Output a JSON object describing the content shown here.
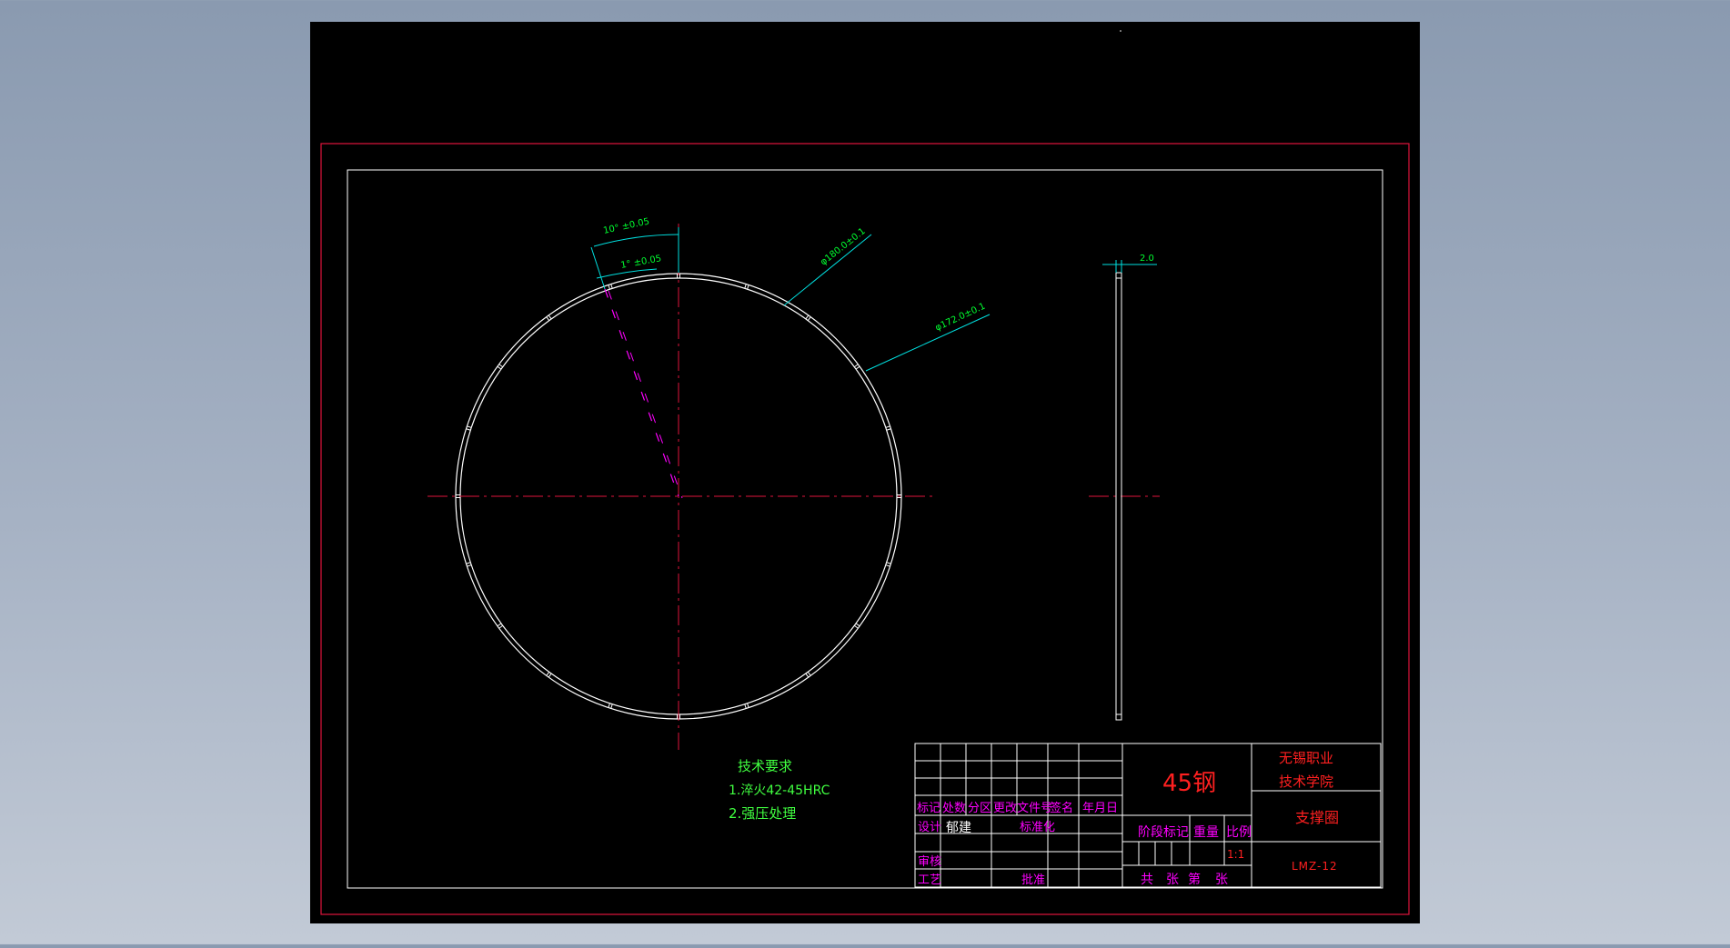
{
  "colors": {
    "background_top": "#8a9ab0",
    "canvas": "#000000",
    "outer_frame": "#e0143c",
    "geometry": "#ffffff",
    "center_line": "#e0143c",
    "dimension": "#00e0e0",
    "dimension_text": "#00ff30",
    "magenta": "#ff00ff",
    "title_red": "#ff2020",
    "tech_green": "#40ff40"
  },
  "dimensions": {
    "angle_outer": "10° ±0.05",
    "angle_inner": "1° ±0.05",
    "outer_diameter": "φ180.0±0.1",
    "inner_diameter": "φ172.0±0.1",
    "thickness": "2.0"
  },
  "tech_requirements": {
    "title": "技术要求",
    "items": [
      "1.淬火42-45HRC",
      "2.强压处理"
    ]
  },
  "title_block": {
    "material": "45钢",
    "school_line1": "无锡职业",
    "school_line2": "技术学院",
    "part_name": "支撑圈",
    "drawing_no": "LMZ-12",
    "revision_header": [
      "标记",
      "处数",
      "分区",
      "更改文件号",
      "签名",
      "年月日"
    ],
    "design_label": "设计",
    "designer": "郁建",
    "standardization_label": "标准化",
    "review_label": "审核",
    "process_label": "工艺",
    "approval_label": "批准",
    "stage_label": "阶段标记",
    "weight_label": "重量",
    "scale_label": "比例",
    "scale_value": "1:1",
    "sheet_total_label": "共",
    "sheet_unit1": "张",
    "sheet_no_label": "第",
    "sheet_unit2": "张"
  }
}
